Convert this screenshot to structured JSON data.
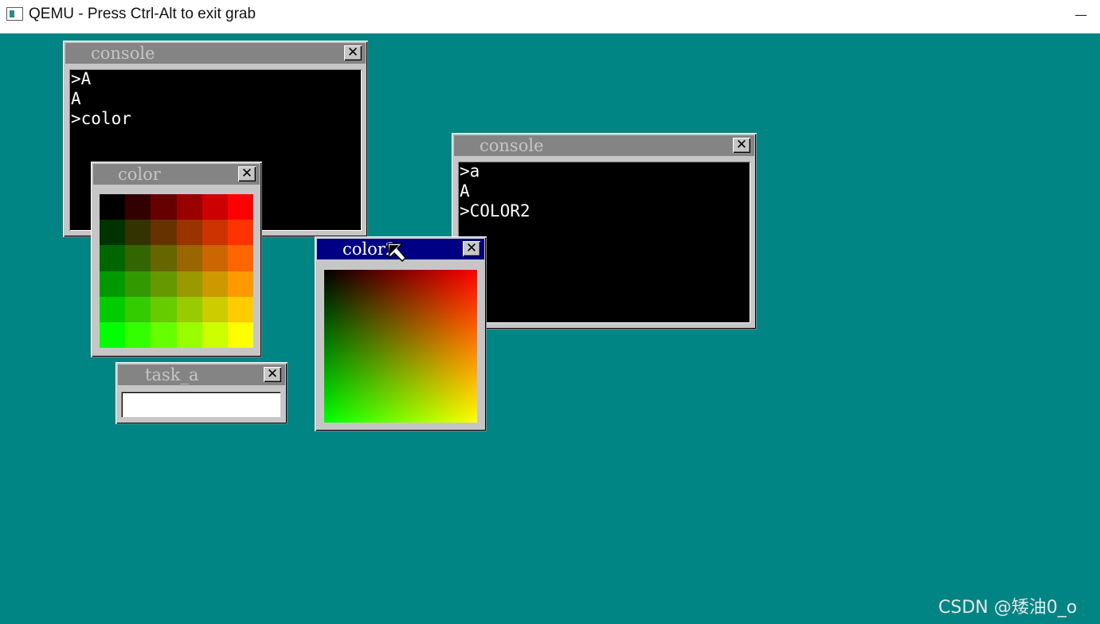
{
  "host_window": {
    "title": "QEMU - Press Ctrl-Alt to exit grab",
    "minimize_glyph": "—"
  },
  "colors": {
    "desktop": "#008484",
    "window_face": "#c6c6c6",
    "inactive_titlebar": "#848484",
    "active_titlebar": "#000084"
  },
  "windows": {
    "console1": {
      "title": "console",
      "close_glyph": "✕",
      "lines": [
        ">A",
        "A",
        ">color"
      ]
    },
    "console2": {
      "title": "console",
      "close_glyph": "✕",
      "lines": [
        ">a",
        "A",
        ">COLOR2"
      ]
    },
    "color1": {
      "title": "color",
      "close_glyph": "✕",
      "palette_rows": 6,
      "palette_cols": 6
    },
    "color2": {
      "title": "color2",
      "close_glyph": "✕",
      "active": true
    },
    "task_a": {
      "title": "task_a",
      "close_glyph": "✕",
      "input_value": ""
    }
  },
  "watermark": "CSDN @矮油0_o",
  "icons": [
    "app-window-icon",
    "close-icon",
    "mouse-cursor-icon"
  ]
}
